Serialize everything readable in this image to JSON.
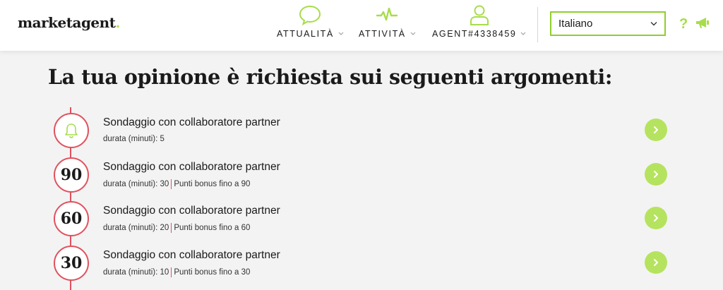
{
  "header": {
    "logo_text": "marketagent",
    "logo_dot": ".",
    "nav": [
      {
        "label": "ATTUALITÀ",
        "icon": "speech-bubble-icon"
      },
      {
        "label": "ATTIVITÀ",
        "icon": "activity-pulse-icon"
      },
      {
        "label": "AGENT#4338459",
        "icon": "user-icon"
      }
    ],
    "language": {
      "selected": "Italiano"
    },
    "help_label": "?",
    "accent_color": "#b5e35f"
  },
  "main": {
    "title": "La tua opinione è richiesta sui seguenti argomenti:",
    "surveys": [
      {
        "badge": "",
        "badge_icon": "bell-icon",
        "title": "Sondaggio con collaboratore partner",
        "duration": "durata (minuti): 5",
        "bonus": ""
      },
      {
        "badge": "90",
        "title": "Sondaggio con collaboratore partner",
        "duration": "durata (minuti): 30",
        "bonus": "Punti bonus fino a 90"
      },
      {
        "badge": "60",
        "title": "Sondaggio con collaboratore partner",
        "duration": "durata (minuti): 20",
        "bonus": "Punti bonus fino a 60"
      },
      {
        "badge": "30",
        "title": "Sondaggio con collaboratore partner",
        "duration": "durata (minuti): 10",
        "bonus": "Punti bonus fino a 30"
      }
    ],
    "timeline_color": "#e0515e"
  }
}
